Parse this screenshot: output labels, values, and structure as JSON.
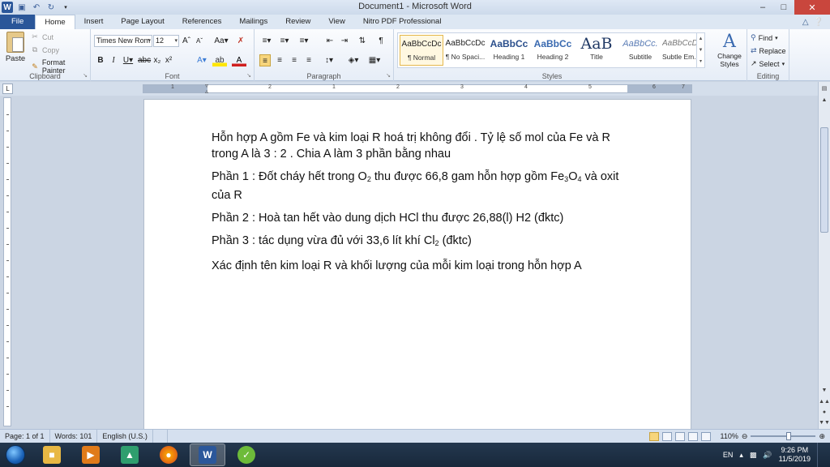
{
  "window": {
    "title": "Document1 - Microsoft Word"
  },
  "tabs": [
    {
      "label": "File"
    },
    {
      "label": "Home"
    },
    {
      "label": "Insert"
    },
    {
      "label": "Page Layout"
    },
    {
      "label": "References"
    },
    {
      "label": "Mailings"
    },
    {
      "label": "Review"
    },
    {
      "label": "View"
    },
    {
      "label": "Nitro PDF Professional"
    }
  ],
  "clipboard": {
    "paste": "Paste",
    "cut": "Cut",
    "copy": "Copy",
    "format_painter": "Format Painter",
    "label": "Clipboard"
  },
  "font": {
    "name": "Times New Rom",
    "size": "12",
    "label": "Font"
  },
  "paragraph": {
    "label": "Paragraph"
  },
  "styles": {
    "label": "Styles",
    "items": [
      {
        "preview": "AaBbCcDc",
        "name": "¶ Normal"
      },
      {
        "preview": "AaBbCcDc",
        "name": "¶ No Spaci..."
      },
      {
        "preview": "AaBbCc",
        "name": "Heading 1"
      },
      {
        "preview": "AaBbCc",
        "name": "Heading 2"
      },
      {
        "preview": "AaB",
        "name": "Title"
      },
      {
        "preview": "AaBbCc.",
        "name": "Subtitle"
      },
      {
        "preview": "AaBbCcDc",
        "name": "Subtle Em..."
      }
    ],
    "change_styles_1": "Change",
    "change_styles_2": "Styles"
  },
  "editing": {
    "find": "Find",
    "replace": "Replace",
    "select": "Select",
    "label": "Editing"
  },
  "ruler_numbers": [
    "1",
    "2",
    "1",
    "2",
    "3",
    "4",
    "5",
    "6",
    "7"
  ],
  "document": {
    "p1": "Hỗn hợp A gồm Fe và kim loại R hoá trị không đổi . Tỷ lệ số mol của Fe và R trong A là 3 : 2 . Chia A làm 3 phần bằng nhau",
    "p2_a": "Phần 1 : Đốt cháy hết trong O",
    "p2_sub1": "2",
    "p2_b": " thu được 66,8 gam hỗn hợp gồm Fe",
    "p2_sub2": "3",
    "p2_c": "O",
    "p2_sub3": "4",
    "p2_d": " và oxit của R",
    "p3": "Phần 2 : Hoà tan hết vào dung dịch HCl thu được 26,88(l) H2 (đktc)",
    "p4_a": "Phần 3 : tác dụng vừa đủ với 33,6 lít khí Cl",
    "p4_sub": "2",
    "p4_b": " (đktc)",
    "p5": "Xác định tên kim loại R và khối lượng của mỗi kim loại trong hỗn hợp A"
  },
  "status": {
    "page": "Page: 1 of 1",
    "words": "Words: 101",
    "language": "English (U.S.)",
    "zoom": "110%"
  },
  "taskbar": {
    "lang": "EN",
    "time": "9:26 PM",
    "date": "11/5/2019"
  }
}
